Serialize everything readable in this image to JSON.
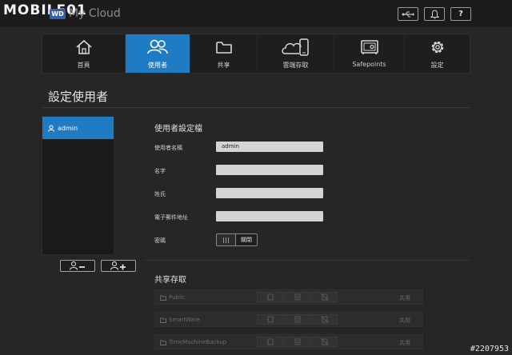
{
  "watermark": "MOBILE01",
  "brand": {
    "logo": "WD",
    "name": "My Cloud"
  },
  "top_buttons": [
    {
      "name": "usb-button",
      "icon": "usb-icon"
    },
    {
      "name": "alerts-button",
      "icon": "bell-icon"
    },
    {
      "name": "help-button",
      "label": "?"
    }
  ],
  "nav": {
    "items": [
      {
        "label": "首頁",
        "icon": "home-icon"
      },
      {
        "label": "使用者",
        "icon": "users-icon",
        "active": true
      },
      {
        "label": "共享",
        "icon": "folder-icon"
      },
      {
        "label": "雲端存取",
        "icon": "cloud-access-icon"
      },
      {
        "label": "Safepoints",
        "icon": "safe-icon"
      },
      {
        "label": "設定",
        "icon": "gear-icon"
      }
    ]
  },
  "page_title": "設定使用者",
  "user_list": {
    "users": [
      {
        "name": "admin",
        "selected": true
      }
    ]
  },
  "profile": {
    "heading": "使用者設定檔",
    "fields": {
      "username": {
        "label": "使用者名稱",
        "value": "admin"
      },
      "first_name": {
        "label": "名字",
        "value": ""
      },
      "last_name": {
        "label": "姓氏",
        "value": ""
      },
      "email": {
        "label": "電子郵件地址",
        "value": ""
      }
    },
    "password": {
      "label": "密碼",
      "state": "關閉"
    }
  },
  "shares": {
    "heading": "共享存取",
    "rows": [
      {
        "name": "Public",
        "status": "共用"
      },
      {
        "name": "SmartWare",
        "status": "共用"
      },
      {
        "name": "TimeMachineBackup",
        "status": "共用"
      }
    ]
  },
  "colors": {
    "accent": "#1f7bc4",
    "background": "#262626",
    "topbar": "#1c1c1c"
  },
  "image_id": "#2207953"
}
